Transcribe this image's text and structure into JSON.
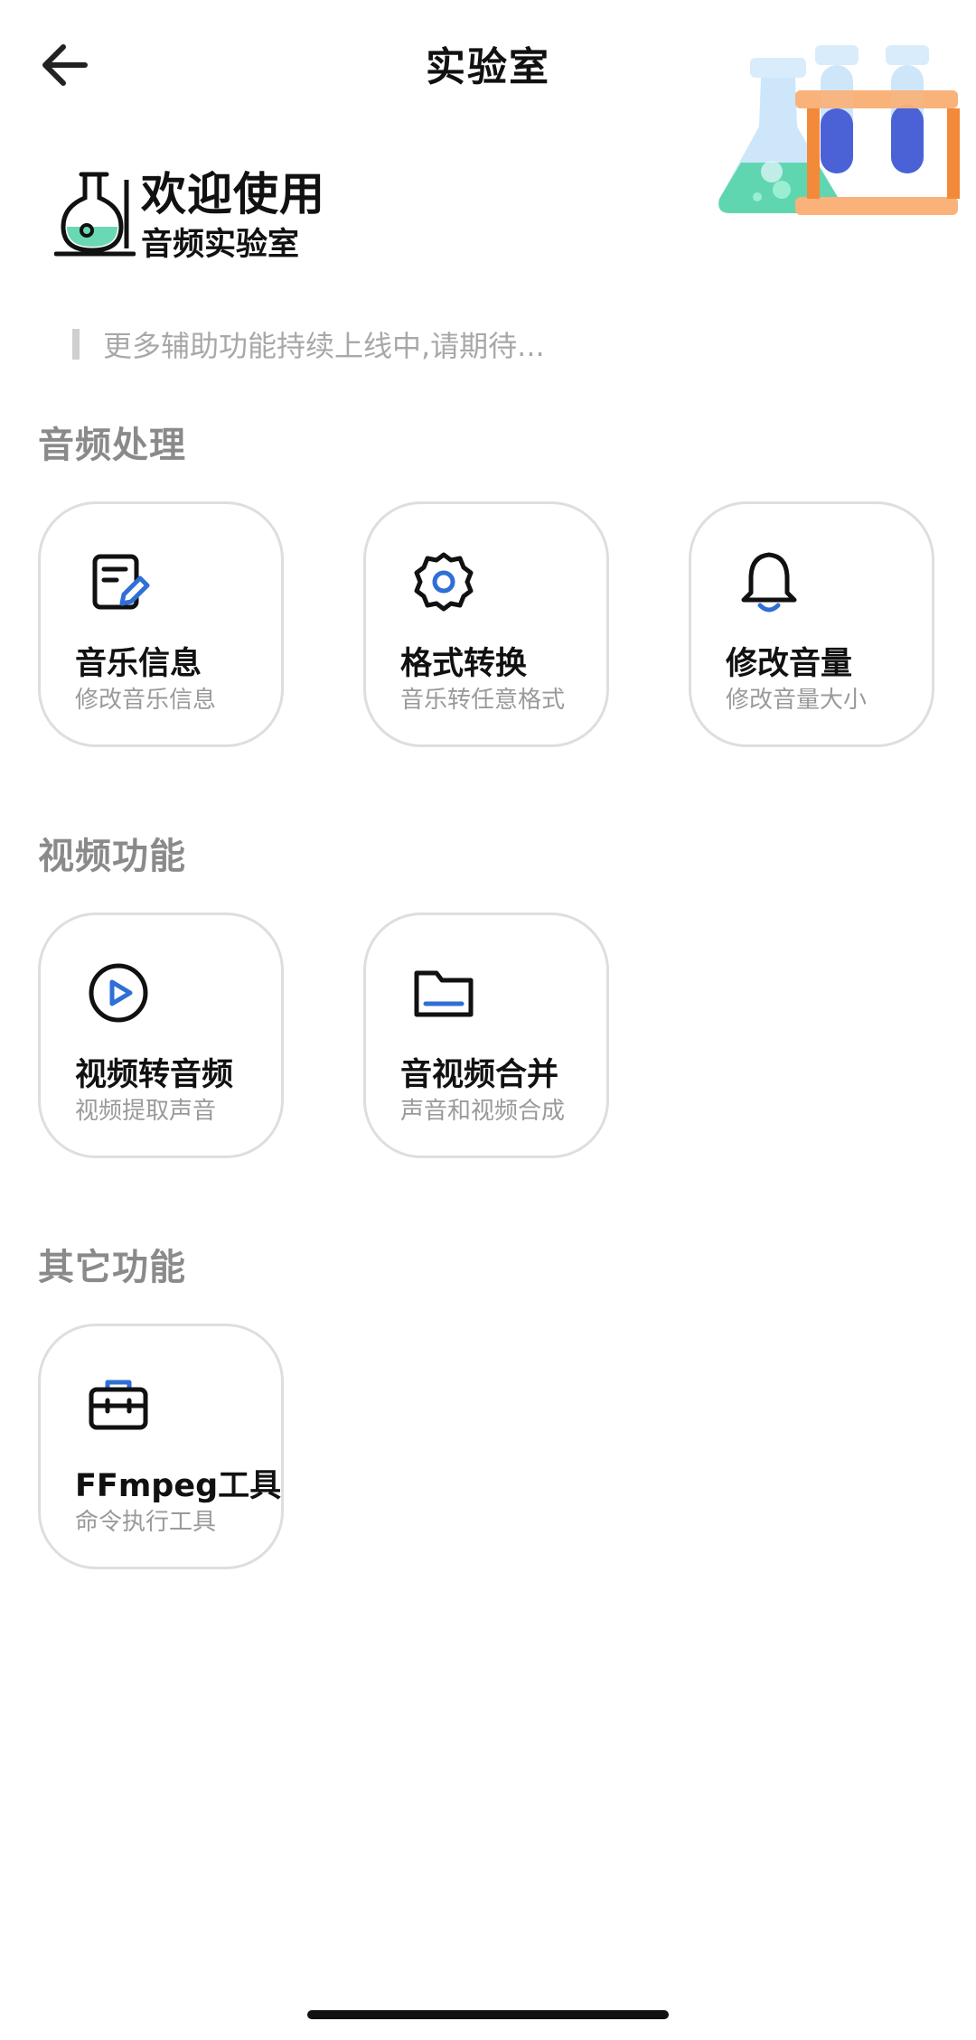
{
  "header": {
    "title": "实验室",
    "back_icon": "arrow-left-icon",
    "illustration": "lab-glassware-illustration"
  },
  "welcome": {
    "icon": "flask-icon",
    "title": "欢迎使用",
    "subtitle": "音频实验室"
  },
  "notice": {
    "text": "更多辅助功能持续上线中,请期待..."
  },
  "sections": [
    {
      "title": "音频处理",
      "cards": [
        {
          "icon": "edit-document-icon",
          "title": "音乐信息",
          "desc": "修改音乐信息"
        },
        {
          "icon": "gear-icon",
          "title": "格式转换",
          "desc": "音乐转任意格式"
        },
        {
          "icon": "bell-icon",
          "title": "修改音量",
          "desc": "修改音量大小"
        }
      ]
    },
    {
      "title": "视频功能",
      "cards": [
        {
          "icon": "play-circle-icon",
          "title": "视频转音频",
          "desc": "视频提取声音"
        },
        {
          "icon": "folder-icon",
          "title": "音视频合并",
          "desc": "声音和视频合成"
        }
      ]
    },
    {
      "title": "其它功能",
      "cards": [
        {
          "icon": "toolbox-icon",
          "title": "FFmpeg工具",
          "desc": "命令执行工具"
        }
      ]
    }
  ],
  "colors": {
    "accent_blue": "#2f6fd6",
    "card_border": "#dedede",
    "section_title": "#8a8a8a",
    "muted_text": "#9a9a9a"
  }
}
